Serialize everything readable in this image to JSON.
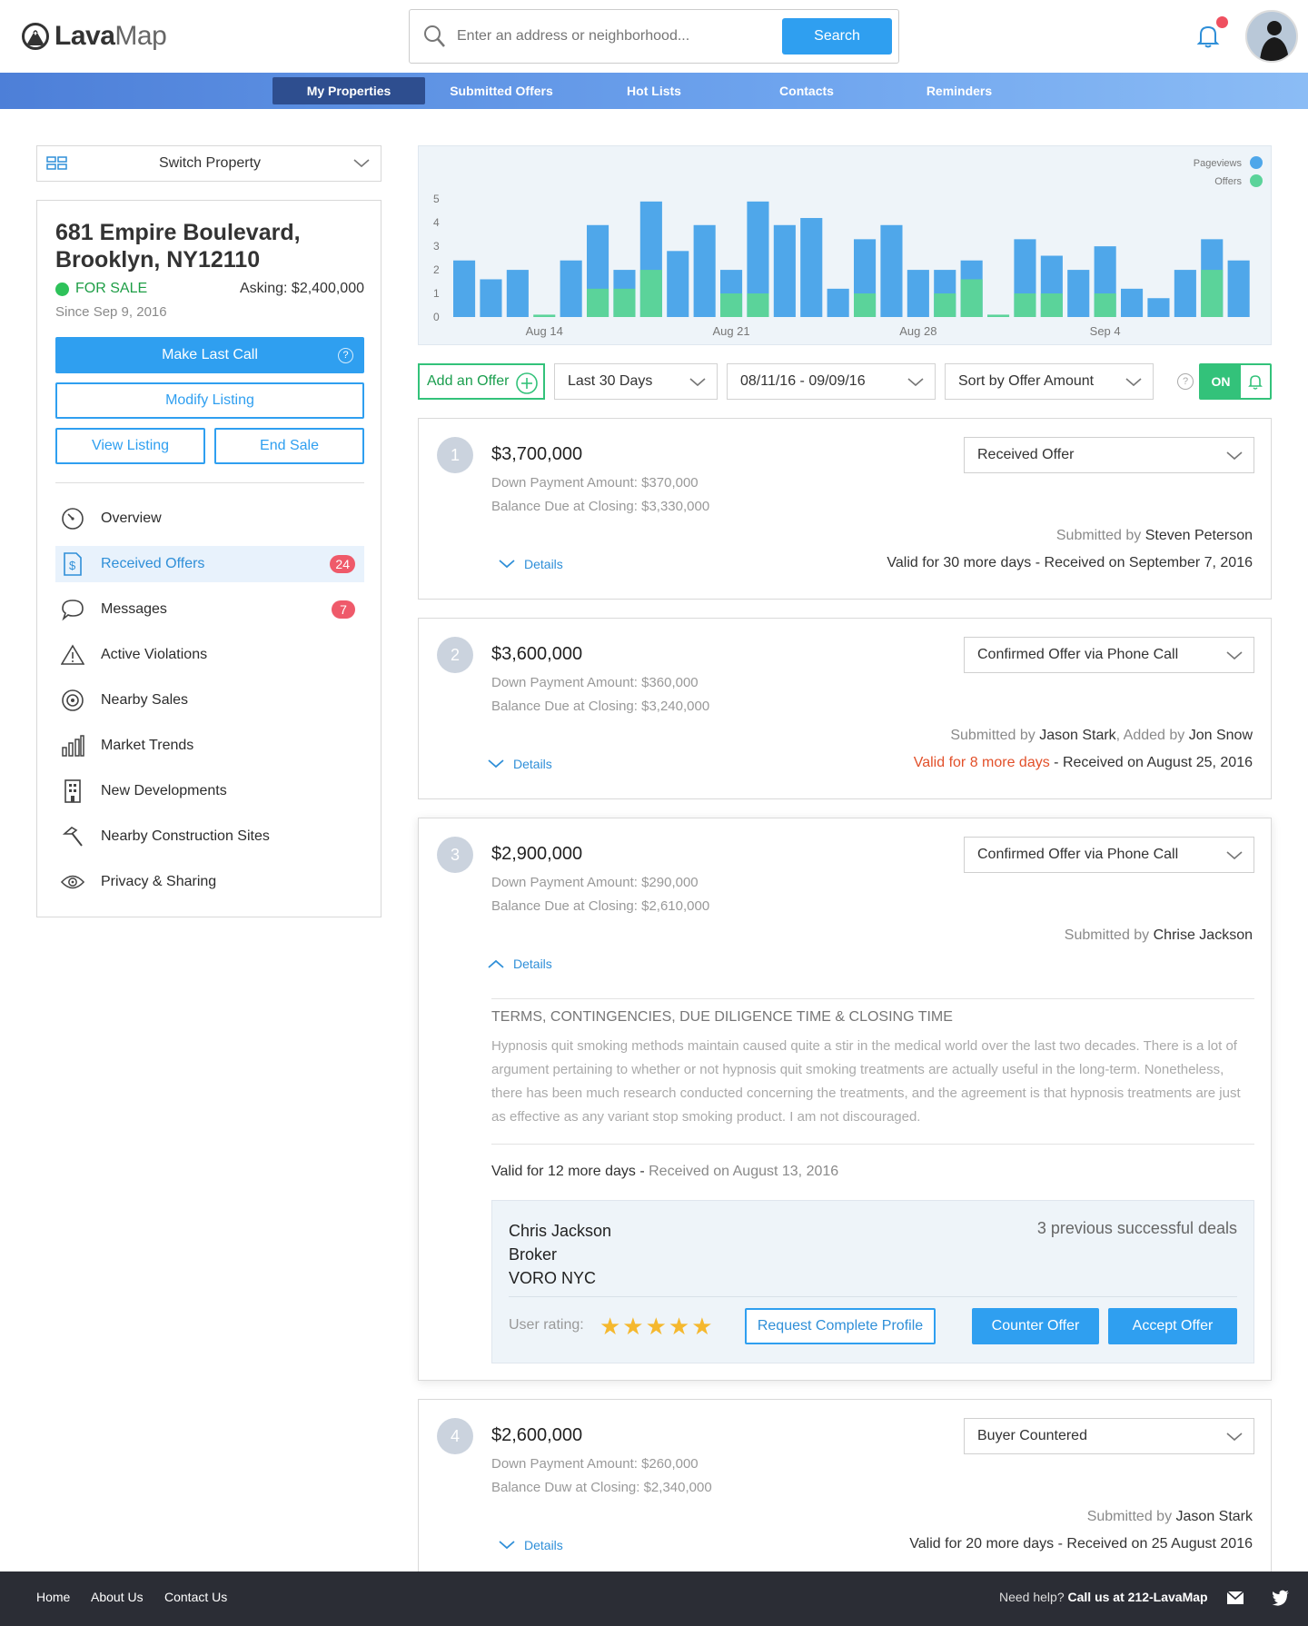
{
  "brand": {
    "logo_bold": "Lava",
    "logo_light": "Map"
  },
  "search": {
    "placeholder": "Enter an address or neighborhood...",
    "button": "Search"
  },
  "nav": {
    "items": [
      "My Properties",
      "Submitted Offers",
      "Hot Lists",
      "Contacts",
      "Reminders"
    ],
    "active": "My Properties"
  },
  "sidebar": {
    "switch_label": "Switch Property",
    "address": "681 Empire Boulevard, Brooklyn, NY12110",
    "status": "FOR SALE",
    "asking": "Asking: $2,400,000",
    "since": "Since Sep 9, 2016",
    "make_last_call": "Make Last Call",
    "modify_listing": "Modify Listing",
    "view_listing": "View Listing",
    "end_sale": "End Sale",
    "menu": [
      {
        "label": "Overview",
        "icon": "gauge-icon",
        "active": false
      },
      {
        "label": "Received Offers",
        "icon": "dollar-doc-icon",
        "active": true,
        "badge": "24"
      },
      {
        "label": "Messages",
        "icon": "chat-bubble-icon",
        "active": false,
        "badge": "7"
      },
      {
        "label": "Active Violations",
        "icon": "warning-icon",
        "active": false
      },
      {
        "label": "Nearby Sales",
        "icon": "target-icon",
        "active": false
      },
      {
        "label": "Market Trends",
        "icon": "bar-chart-icon",
        "active": false
      },
      {
        "label": "New Developments",
        "icon": "building-icon",
        "active": false
      },
      {
        "label": "Nearby Construction Sites",
        "icon": "hammer-icon",
        "active": false
      },
      {
        "label": "Privacy & Sharing",
        "icon": "eye-icon",
        "active": false
      }
    ]
  },
  "chart_data": {
    "type": "bar",
    "legend": [
      "Pageviews",
      "Offers"
    ],
    "legend_position": "top-right",
    "colors": {
      "Pageviews": "#4fa7ea",
      "Offers": "#5bd39a"
    },
    "yticks": [
      "0",
      "1",
      "2",
      "3",
      "4",
      "5"
    ],
    "ylim": [
      0,
      5.4
    ],
    "xtick_labels": [
      {
        "label": "Aug 14",
        "index": 3
      },
      {
        "label": "Aug 21",
        "index": 10
      },
      {
        "label": "Aug 28",
        "index": 17
      },
      {
        "label": "Sep 4",
        "index": 24
      }
    ],
    "series": [
      {
        "name": "Pageviews",
        "values": [
          2.4,
          1.6,
          2.0,
          0,
          2.4,
          3.9,
          2.0,
          4.9,
          2.8,
          3.9,
          2.0,
          4.9,
          3.9,
          4.2,
          1.2,
          3.3,
          3.9,
          2.0,
          2.0,
          2.4,
          0,
          3.3,
          2.6,
          2.0,
          3.0,
          1.2,
          0.8,
          2.0,
          3.3,
          2.4
        ]
      },
      {
        "name": "Offers",
        "values": [
          0,
          0,
          0,
          0.1,
          0,
          1.2,
          1.2,
          2.0,
          0,
          0,
          1.0,
          1.0,
          0,
          0,
          0,
          1.0,
          0,
          0,
          1.0,
          1.6,
          0.1,
          1.0,
          1.0,
          0,
          1.0,
          0,
          0,
          0,
          2.0,
          0
        ]
      }
    ]
  },
  "toolbar": {
    "add_offer": "Add an Offer",
    "range": "Last 30 Days",
    "dates": "08/11/16 - 09/09/16",
    "sort": "Sort by Offer Amount",
    "toggle": "ON"
  },
  "offers": [
    {
      "num": "1",
      "price": "$3,700,000",
      "down": "Down Payment Amount: $370,000",
      "balance": "Balance Due at Closing: $3,330,000",
      "status": "Received Offer",
      "submitted_prefix": "Submitted by ",
      "submitted_by": "Steven Peterson",
      "added_prefix": "",
      "added_by": "",
      "valid_prefix": "Valid for 30 more days",
      "valid_suffix": " - Received on September 7, 2016",
      "details": "Details"
    },
    {
      "num": "2",
      "price": "$3,600,000",
      "down": "Down Payment Amount: $360,000",
      "balance": "Balance Due at Closing: $3,240,000",
      "status": "Confirmed Offer via Phone Call",
      "submitted_prefix": "Submitted by ",
      "submitted_by": "Jason Stark",
      "added_prefix": ", Added by ",
      "added_by": "Jon Snow",
      "valid_prefix": "Valid for 8 more days",
      "valid_suffix": " - Received on August 25, 2016",
      "details": "Details"
    },
    {
      "num": "3",
      "price": "$2,900,000",
      "down": "Down Payment Amount: $290,000",
      "balance": "Balance Due at Closing: $2,610,000",
      "status": "Confirmed  Offer via Phone Call",
      "submitted_prefix": "Submitted by ",
      "submitted_by": "Chrise Jackson",
      "details": "Details",
      "terms_title": "TERMS, CONTINGENCIES, DUE DILIGENCE TIME & CLOSING TIME",
      "terms_text": "Hypnosis quit smoking methods maintain caused quite a stir in the medical world over the last two decades. There is a lot of argument pertaining to whether or not hypnosis quit smoking treatments are actually useful in the long-term. Nonetheless, there has been much research conducted concerning the treatments, and the agreement is that hypnosis treatments are just as effective as any variant stop smoking product.  I am not discouraged.",
      "valid_prefix": "Valid for 12 more days - ",
      "valid_suffix": "Received on August 13, 2016",
      "broker": {
        "name": "Chris Jackson",
        "role": "Broker",
        "company": "VORO NYC",
        "deals": "3 previous successful deals",
        "rating_label": "User rating:",
        "stars": "★★★★★",
        "rating": 5,
        "request": "Request Complete Profile",
        "counter": "Counter Offer",
        "accept": "Accept Offer"
      }
    },
    {
      "num": "4",
      "price": "$2,600,000",
      "down": "Down Payment Amount: $260,000",
      "balance": "Balance Duw at Closing: $2,340,000",
      "status": "Buyer Countered",
      "submitted_prefix": "Submitted by ",
      "submitted_by": "Jason Stark",
      "valid_prefix": "Valid for 20 more days",
      "valid_suffix": " - Received on 25 August 2016",
      "details": "Details"
    }
  ],
  "footer": {
    "links": [
      "Home",
      "About Us",
      "Contact Us"
    ],
    "help_prefix": "Need help?",
    "help_phone": "Call us at 212-LavaMap"
  }
}
